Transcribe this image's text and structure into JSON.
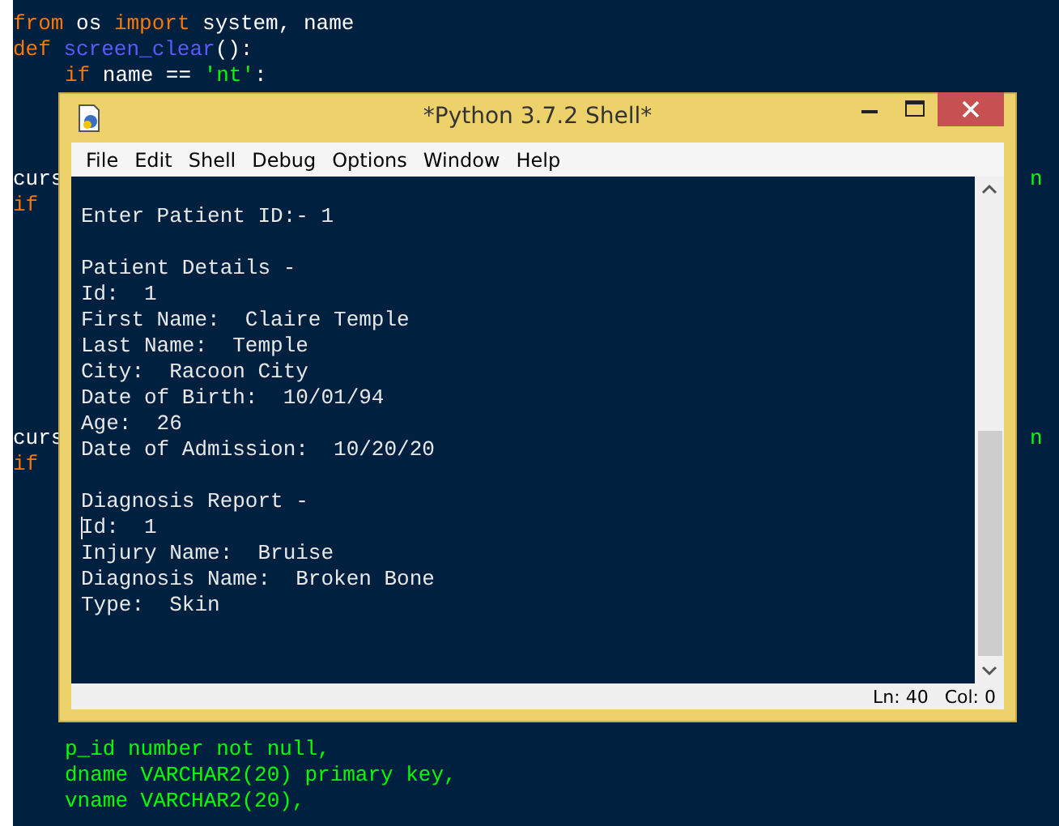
{
  "editor": {
    "lines": [
      {
        "indent": false,
        "segments": [
          {
            "kind": "keyword",
            "text": "from"
          },
          {
            "kind": "plain",
            "text": " os "
          },
          {
            "kind": "keyword",
            "text": "import"
          },
          {
            "kind": "plain",
            "text": " system, name"
          }
        ]
      },
      {
        "indent": false,
        "segments": [
          {
            "kind": "keyword",
            "text": "def"
          },
          {
            "kind": "name",
            "text": " screen_clear"
          },
          {
            "kind": "plain",
            "text": "():"
          }
        ]
      },
      {
        "indent": true,
        "segments": [
          {
            "kind": "keyword",
            "text": "if"
          },
          {
            "kind": "plain",
            "text": " name == "
          },
          {
            "kind": "string",
            "text": "'nt'"
          },
          {
            "kind": "plain",
            "text": ":"
          }
        ]
      },
      {
        "indent": false,
        "segments": [
          {
            "kind": "plain",
            "text": "curs"
          }
        ]
      },
      {
        "indent": false,
        "segments": [
          {
            "kind": "keyword",
            "text": "if"
          }
        ]
      },
      {
        "indent": false,
        "segments": [
          {
            "kind": "plain",
            "text": "curs"
          }
        ]
      },
      {
        "indent": false,
        "segments": [
          {
            "kind": "keyword",
            "text": "if"
          }
        ]
      },
      {
        "indent": true,
        "segments": [
          {
            "kind": "string",
            "text": "p_id number not null,"
          }
        ]
      },
      {
        "indent": true,
        "segments": [
          {
            "kind": "string",
            "text": "dname VARCHAR2(20) primary key,"
          }
        ]
      },
      {
        "indent": true,
        "segments": [
          {
            "kind": "string",
            "text": "vname VARCHAR2(20),"
          }
        ]
      }
    ],
    "right_fragments": [
      {
        "kind": "string",
        "text": "n"
      },
      {
        "kind": "string",
        "text": "n"
      }
    ]
  },
  "window": {
    "title": "*Python 3.7.2 Shell*",
    "menu": [
      "File",
      "Edit",
      "Shell",
      "Debug",
      "Options",
      "Window",
      "Help"
    ],
    "shell_blocks": [
      {
        "lines": [
          {
            "text": "Enter Patient ID:- 1",
            "cursor": false
          }
        ]
      },
      {
        "lines": [
          {
            "text": "Patient Details -",
            "cursor": false
          },
          {
            "text": "Id:  1",
            "cursor": false
          },
          {
            "text": "First Name:  Claire Temple",
            "cursor": false
          },
          {
            "text": "Last Name:  Temple",
            "cursor": false
          },
          {
            "text": "City:  Racoon City",
            "cursor": false
          },
          {
            "text": "Date of Birth:  10/01/94",
            "cursor": false
          },
          {
            "text": "Age:  26",
            "cursor": false
          },
          {
            "text": "Date of Admission:  10/20/20",
            "cursor": false
          }
        ]
      },
      {
        "lines": [
          {
            "text": "Diagnosis Report -",
            "cursor": false
          },
          {
            "text": "Id:  1",
            "cursor": true
          },
          {
            "text": "Injury Name:  Bruise",
            "cursor": false
          },
          {
            "text": "Diagnosis Name:  Broken Bone",
            "cursor": false
          },
          {
            "text": "Type:  Skin",
            "cursor": false
          }
        ]
      }
    ],
    "status": {
      "line": "Ln: 40",
      "col": "Col: 0"
    }
  }
}
